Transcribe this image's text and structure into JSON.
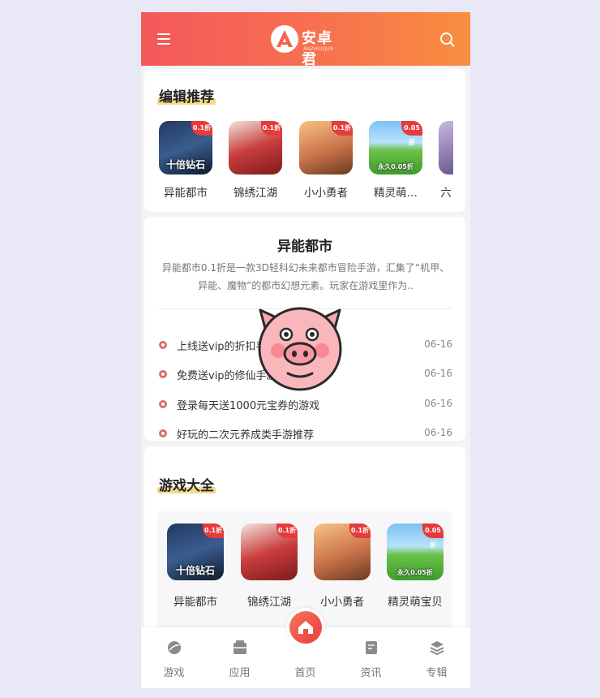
{
  "header": {
    "logo_text": "安卓君",
    "logo_sub": "ANZHUOJUN"
  },
  "editor_picks": {
    "title": "编辑推荐",
    "apps": [
      {
        "name": "异能都市",
        "badge": "0.1折",
        "caption": "十倍钻石"
      },
      {
        "name": "锦绣江湖",
        "badge": "0.1折",
        "caption": ""
      },
      {
        "name": "小小勇者",
        "badge": "0.1折",
        "caption": ""
      },
      {
        "name": "精灵萌…",
        "badge": "0.05折",
        "caption": "永久0.05折"
      },
      {
        "name": "六",
        "badge": "",
        "caption": ""
      }
    ]
  },
  "featured": {
    "title": "异能都市",
    "description": "异能都市0.1折是一款3D轻科幻未来都市冒险手游，汇集了“机甲、异能、魔物”的都市幻想元素。玩家在游戏里作为..",
    "news": [
      {
        "title": "上线送vip的折扣手游",
        "date": "06-16"
      },
      {
        "title": "免费送vip的修仙手游",
        "date": "06-16"
      },
      {
        "title": "登录每天送1000元宝券的游戏",
        "date": "06-16"
      },
      {
        "title": "好玩的二次元养成类手游推荐",
        "date": "06-16"
      }
    ]
  },
  "game_list": {
    "title": "游戏大全",
    "apps": [
      {
        "name": "异能都市",
        "badge": "0.1折",
        "caption": "十倍钻石"
      },
      {
        "name": "锦绣江湖",
        "badge": "0.1折",
        "caption": ""
      },
      {
        "name": "小小勇者",
        "badge": "0.1折",
        "caption": ""
      },
      {
        "name": "精灵萌宝贝",
        "badge": "0.05折",
        "caption": "永久0.05折"
      }
    ]
  },
  "tabbar": [
    {
      "label": "游戏",
      "icon": "game-icon"
    },
    {
      "label": "应用",
      "icon": "app-icon"
    },
    {
      "label": "首页",
      "icon": "home-icon"
    },
    {
      "label": "资讯",
      "icon": "news-icon"
    },
    {
      "label": "专辑",
      "icon": "album-icon"
    }
  ],
  "colors": {
    "header_start": "#f4585b",
    "header_end": "#f88e3f",
    "accent": "#e43b3b",
    "title_highlight": "#f7d98b"
  }
}
